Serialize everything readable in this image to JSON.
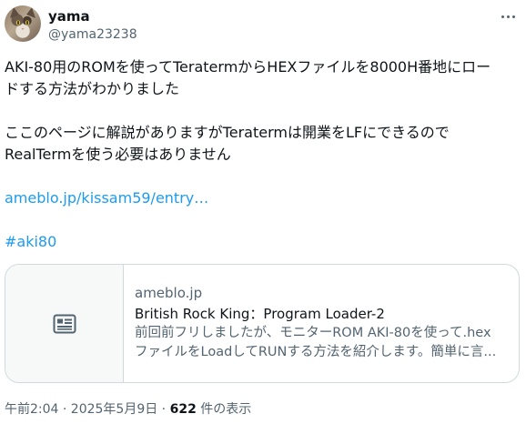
{
  "user": {
    "name": "yama",
    "handle": "@yama23238"
  },
  "tweet": {
    "line1": "AKI-80用のROMを使ってTeratermからHEXファイルを8000H番地にロー",
    "line2": "ドする方法がわかりました",
    "line3": "ここのページに解説がありますがTeratermは開業をLFにできるので",
    "line4": "RealTermを使う必要はありません",
    "link": "ameblo.jp/kissam59/entry…",
    "hashtag": "#aki80"
  },
  "card": {
    "domain": "ameblo.jp",
    "title": "British Rock King：Program Loader-2",
    "desc1": "前回前フリしましたが、モニターROM AKI-80を使って.hex",
    "desc2": "ファイルをLoadしてRUNする方法を紹介します。簡単に言..."
  },
  "meta": {
    "datetime": "午前2:04 · 2025年5月9日 · ",
    "views_count": "622",
    "views_label": " 件の表示"
  },
  "icons": {
    "more": "more-horizontal-icon",
    "card_placeholder": "article-icon"
  },
  "colors": {
    "link": "#1d9bf0",
    "secondary_text": "#536471",
    "border": "#cfd9de"
  }
}
